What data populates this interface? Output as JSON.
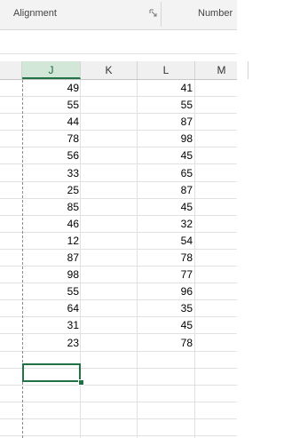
{
  "ribbon": {
    "group_alignment": "Alignment",
    "group_number": "Number",
    "launcher_icon": "dialog-launcher-icon"
  },
  "columns": [
    "J",
    "K",
    "L",
    "M"
  ],
  "selected_column": "J",
  "rows": [
    {
      "j": "49",
      "l": "41"
    },
    {
      "j": "55",
      "l": "55"
    },
    {
      "j": "44",
      "l": "87"
    },
    {
      "j": "78",
      "l": "98"
    },
    {
      "j": "56",
      "l": "45"
    },
    {
      "j": "33",
      "l": "65"
    },
    {
      "j": "25",
      "l": "87"
    },
    {
      "j": "85",
      "l": "45"
    },
    {
      "j": "46",
      "l": "32"
    },
    {
      "j": "12",
      "l": "54"
    },
    {
      "j": "87",
      "l": "78"
    },
    {
      "j": "98",
      "l": "77"
    },
    {
      "j": "55",
      "l": "96"
    },
    {
      "j": "64",
      "l": "35"
    },
    {
      "j": "31",
      "l": "45"
    },
    {
      "j": "23",
      "l": "78"
    }
  ],
  "colors": {
    "accent": "#217346",
    "header_bg": "#f0f0f0",
    "selected_header_bg": "#d3e7d8",
    "gridline": "#e1e1e1"
  }
}
